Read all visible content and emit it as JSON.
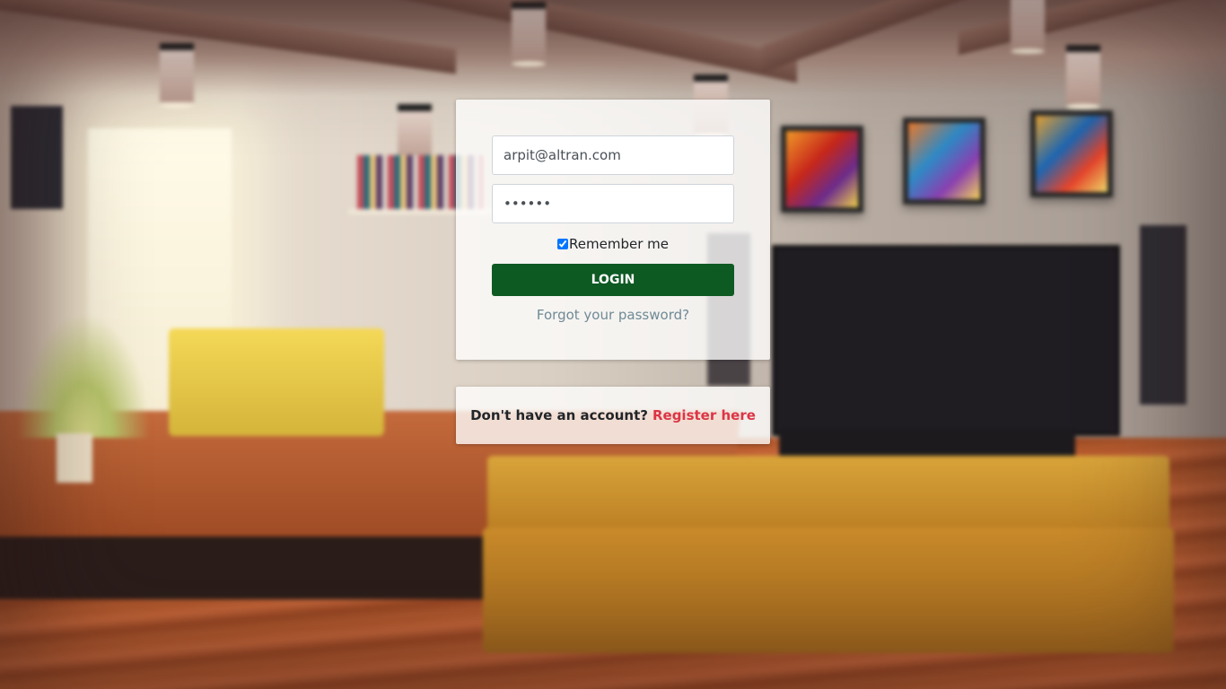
{
  "login": {
    "email_value": "arpit@altran.com",
    "password_value": "abcdef",
    "remember_label": "Remember me",
    "remember_checked": true,
    "login_button": "LOGIN",
    "forgot_link": "Forgot your password?"
  },
  "register": {
    "prompt": "Don't have an account?",
    "link": "Register here"
  },
  "colors": {
    "login_button_bg": "#0e5a23",
    "register_link": "#dc3545",
    "forgot_link": "#6f8a95"
  }
}
